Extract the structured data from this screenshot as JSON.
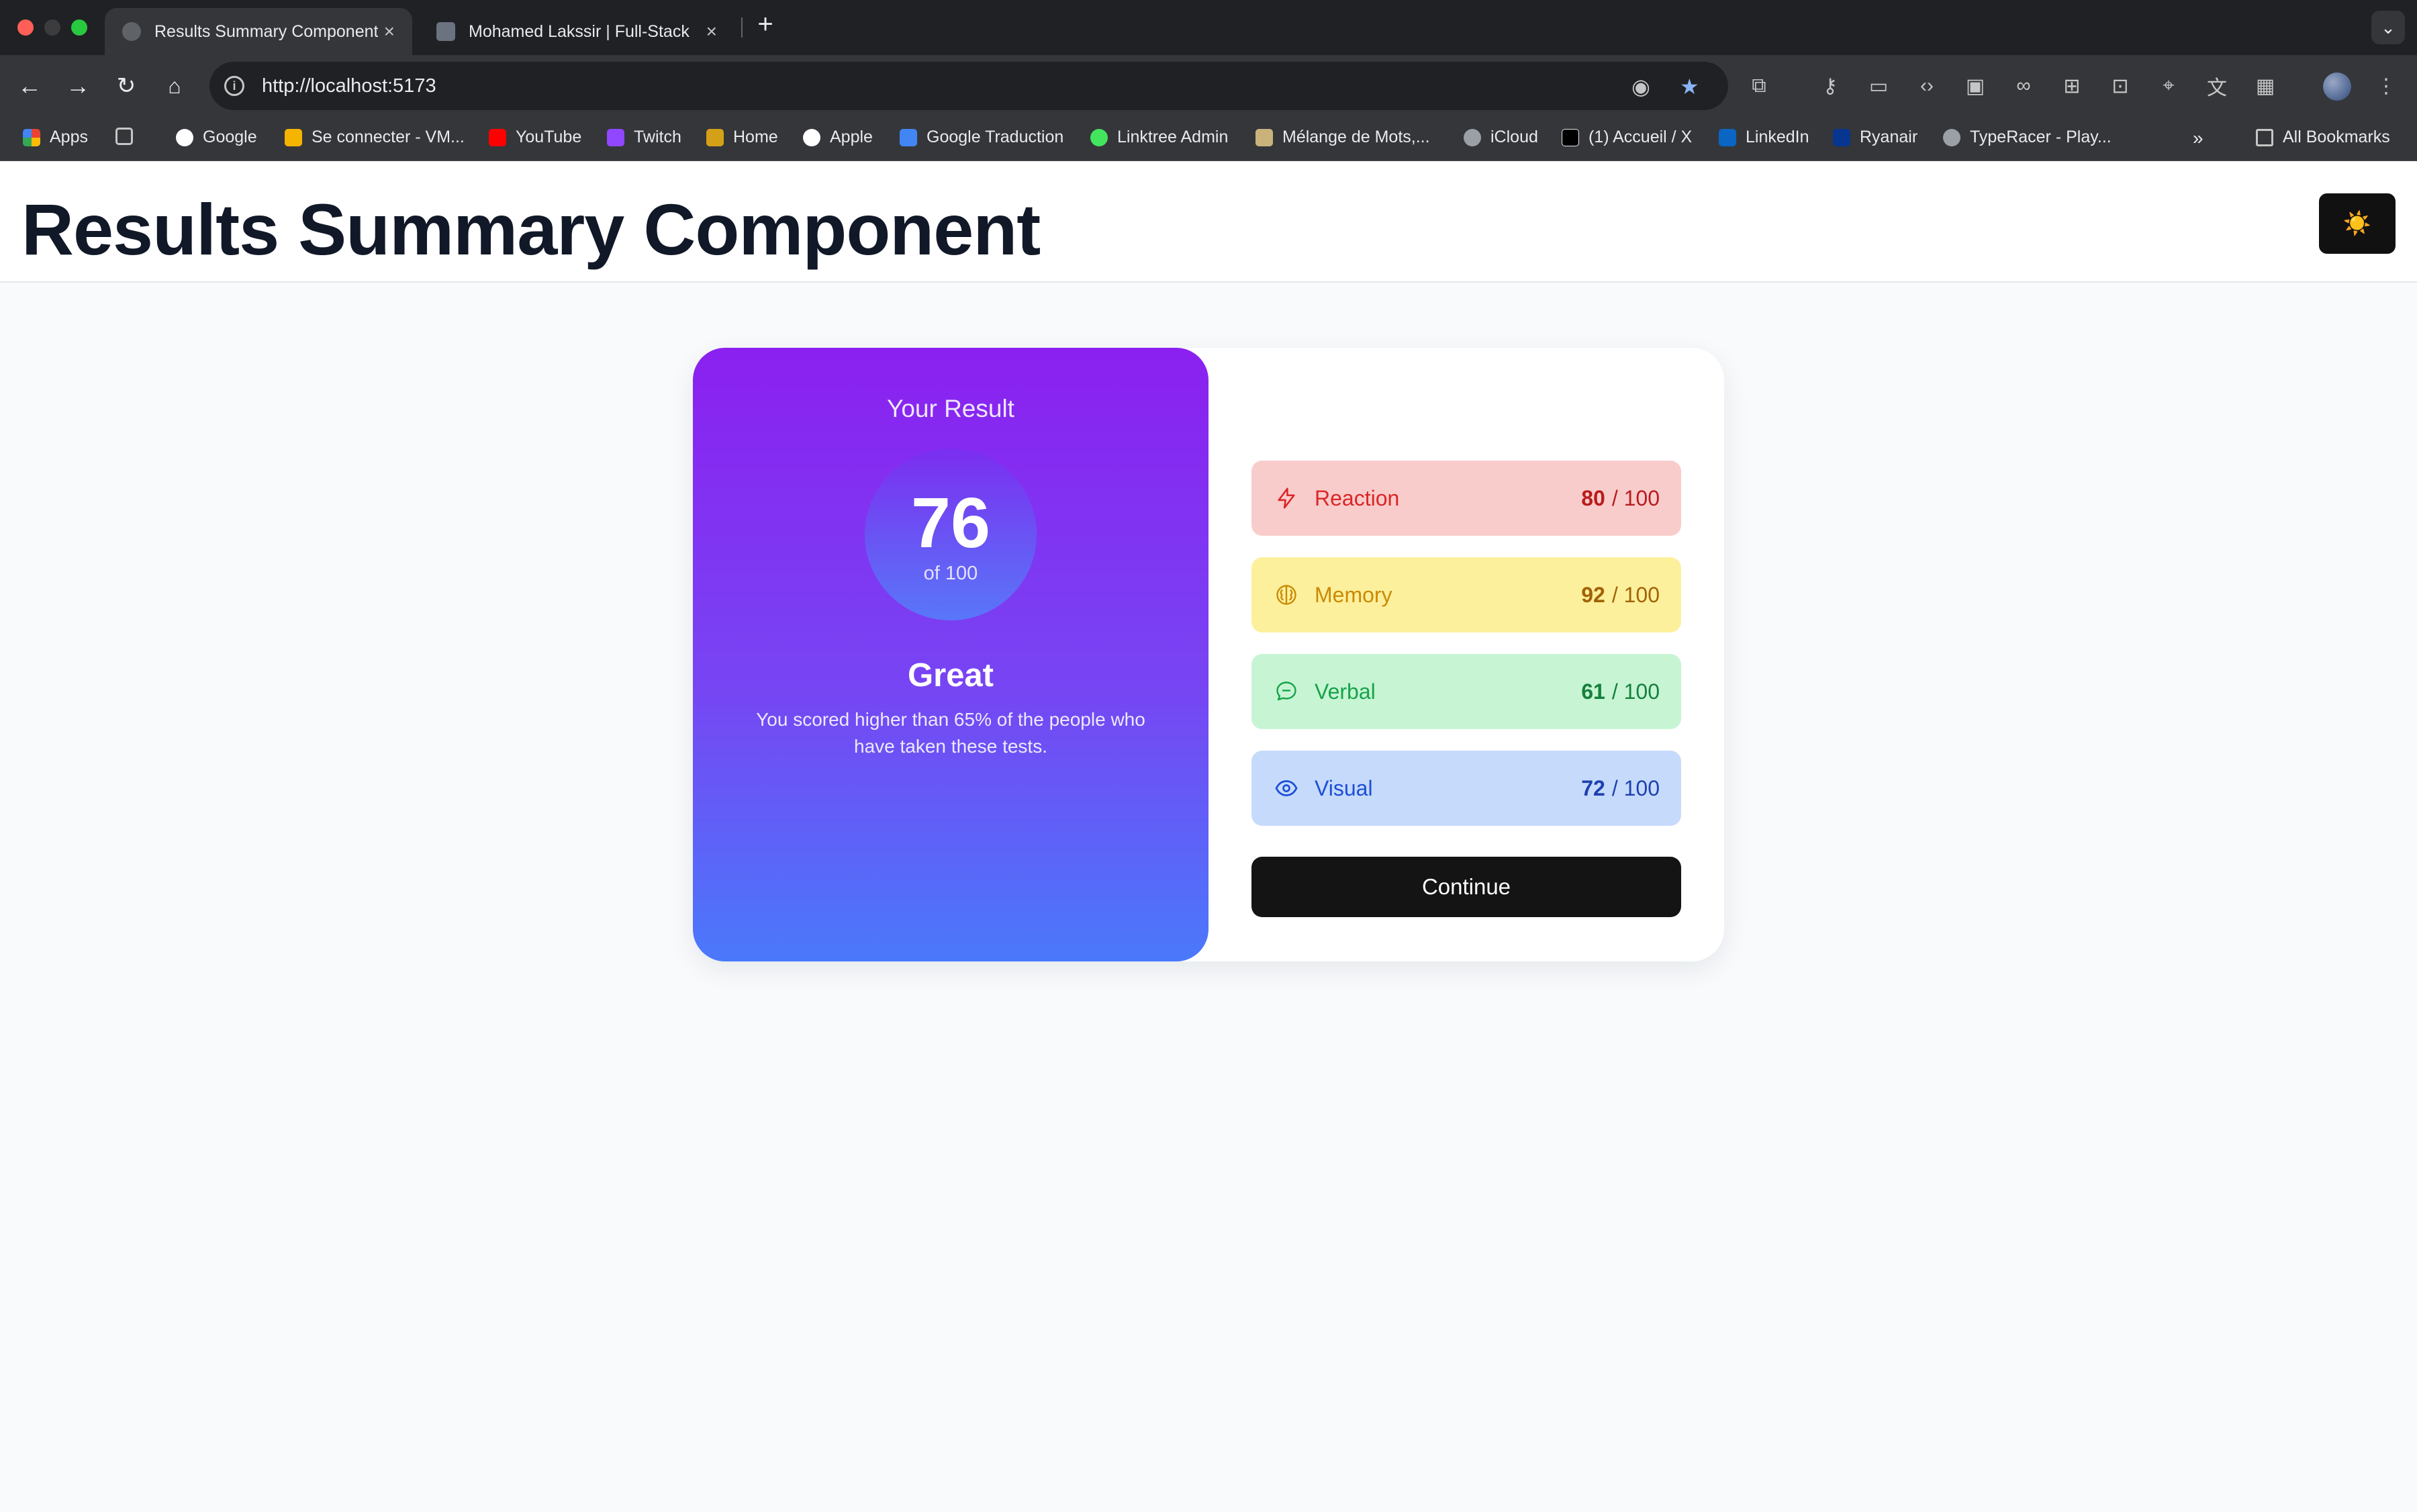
{
  "browser": {
    "tabs": [
      {
        "title": "Results Summary Component",
        "active": true
      },
      {
        "title": "Mohamed Lakssir | Full-Stack",
        "active": false
      }
    ],
    "url": "http://localhost:5173",
    "bookmarks": [
      {
        "label": "Apps",
        "icon": "apps-grid-icon",
        "color": "#ea4335"
      },
      {
        "label": "Google",
        "icon": "google-icon",
        "color": "#ffffff"
      },
      {
        "label": "Se connecter - VM...",
        "icon": "vm-icon",
        "color": "#f4b400"
      },
      {
        "label": "YouTube",
        "icon": "youtube-icon",
        "color": "#ff0000"
      },
      {
        "label": "Twitch",
        "icon": "twitch-icon",
        "color": "#9146ff"
      },
      {
        "label": "Home",
        "icon": "home-bookmark-icon",
        "color": "#d4a017"
      },
      {
        "label": "Apple",
        "icon": "apple-icon",
        "color": "#ffffff"
      },
      {
        "label": "Google Traduction",
        "icon": "translate-icon",
        "color": "#4285f4"
      },
      {
        "label": "Linktree Admin",
        "icon": "linktree-icon",
        "color": "#43e55e"
      },
      {
        "label": "Mélange de Mots,...",
        "icon": "words-icon",
        "color": "#c9b37a"
      },
      {
        "label": "iCloud",
        "icon": "icloud-icon",
        "color": "#9aa0a6"
      },
      {
        "label": "(1) Accueil / X",
        "icon": "x-icon",
        "color": "#000000"
      },
      {
        "label": "LinkedIn",
        "icon": "linkedin-icon",
        "color": "#0a66c2"
      },
      {
        "label": "Ryanair",
        "icon": "ryanair-icon",
        "color": "#073590"
      },
      {
        "label": "TypeRacer - Play...",
        "icon": "globe-icon",
        "color": "#9aa0a6"
      }
    ],
    "all_bookmarks": "All Bookmarks"
  },
  "header": {
    "title": "Results Summary Component",
    "theme_icon": "☀️"
  },
  "result": {
    "heading": "Your Result",
    "score": "76",
    "score_of": "of 100",
    "rating": "Great",
    "description": "You scored higher than 65% of the people who have taken these tests."
  },
  "summary": {
    "categories": [
      {
        "label": "Reaction",
        "score": "80",
        "max": "/ 100",
        "icon": "lightning-icon",
        "bg": "#f9cccc",
        "color": "#dc2626"
      },
      {
        "label": "Memory",
        "score": "92",
        "max": "/ 100",
        "icon": "brain-icon",
        "bg": "#fdf09c",
        "color": "#ca8a04"
      },
      {
        "label": "Verbal",
        "score": "61",
        "max": "/ 100",
        "icon": "chat-bubble-icon",
        "bg": "#c7f5d4",
        "color": "#16a34a"
      },
      {
        "label": "Visual",
        "score": "72",
        "max": "/ 100",
        "icon": "eye-icon",
        "bg": "#c6dafb",
        "color": "#1d4ed8"
      }
    ],
    "continue_label": "Continue"
  }
}
